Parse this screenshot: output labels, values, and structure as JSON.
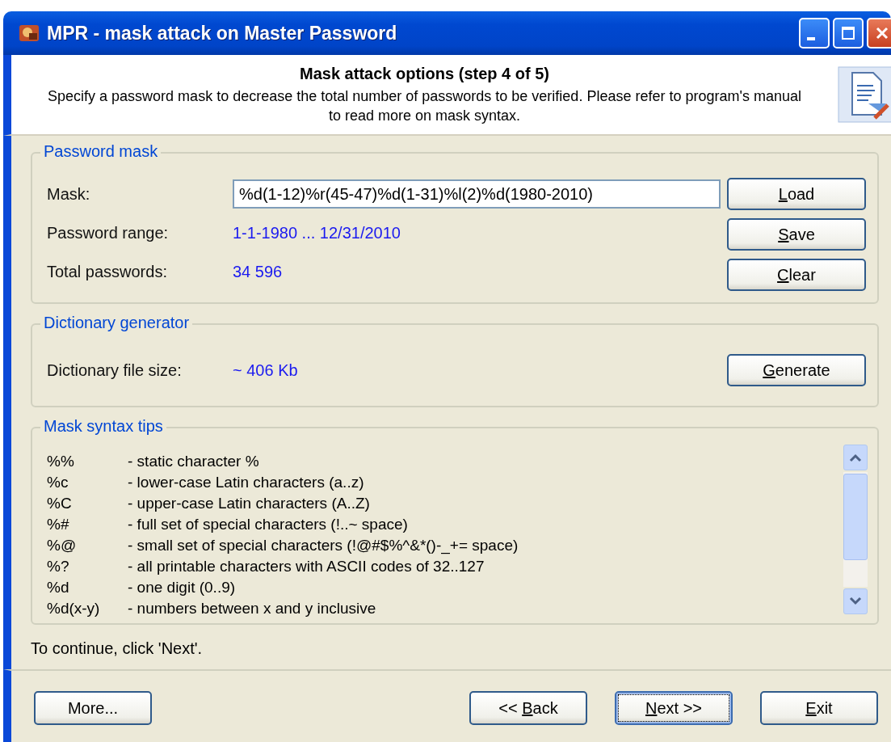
{
  "window": {
    "title": "MPR - mask attack on Master Password"
  },
  "header": {
    "title": "Mask attack options (step 4 of 5)",
    "description": "Specify a password mask to decrease the total number of passwords to be verified. Please refer to program's manual to read more on mask syntax."
  },
  "password_mask": {
    "title": "Password mask",
    "mask_label": "Mask:",
    "mask_value": "%d(1-12)%r(45-47)%d(1-31)%l(2)%d(1980-2010)",
    "rows": [
      {
        "label": "Password range:",
        "value": "1-1-1980 ... 12/31/2010"
      },
      {
        "label": "Total passwords:",
        "value": "34 596"
      }
    ],
    "buttons": [
      {
        "key": "L",
        "after": "oad"
      },
      {
        "key": "S",
        "after": "ave"
      },
      {
        "key": "C",
        "after": "lear"
      }
    ]
  },
  "dictionary": {
    "title": "Dictionary generator",
    "label": "Dictionary file size:",
    "value": "~ 406  Kb",
    "button": {
      "key": "G",
      "after": "enerate"
    }
  },
  "tips": {
    "title": "Mask syntax tips",
    "items": [
      {
        "code": "%%",
        "text": "- static character %"
      },
      {
        "code": "%c",
        "text": "- lower-case Latin characters  (a..z)"
      },
      {
        "code": "%C",
        "text": "- upper-case Latin characters (A..Z)"
      },
      {
        "code": "%#",
        "text": "- full set of special characters (!..~ space)"
      },
      {
        "code": "%@",
        "text": "- small set of special characters (!@#$%^&*()-_+= space)"
      },
      {
        "code": "%?",
        "text": "- all printable characters with ASCII codes of 32..127"
      },
      {
        "code": "%d",
        "text": "- one digit (0..9)"
      },
      {
        "code": "%d(x-y)",
        "text": "- numbers between x and y inclusive"
      }
    ]
  },
  "hint": "To continue, click 'Next'.",
  "left_buttons": [
    {
      "before": "More...",
      "focused": false
    }
  ],
  "right_buttons": [
    {
      "before": "<< ",
      "key": "B",
      "after": "ack",
      "focused": false
    },
    {
      "key": "N",
      "after": "ext >>",
      "focused": true
    },
    {
      "key": "E",
      "after": "xit",
      "focused": false
    }
  ]
}
